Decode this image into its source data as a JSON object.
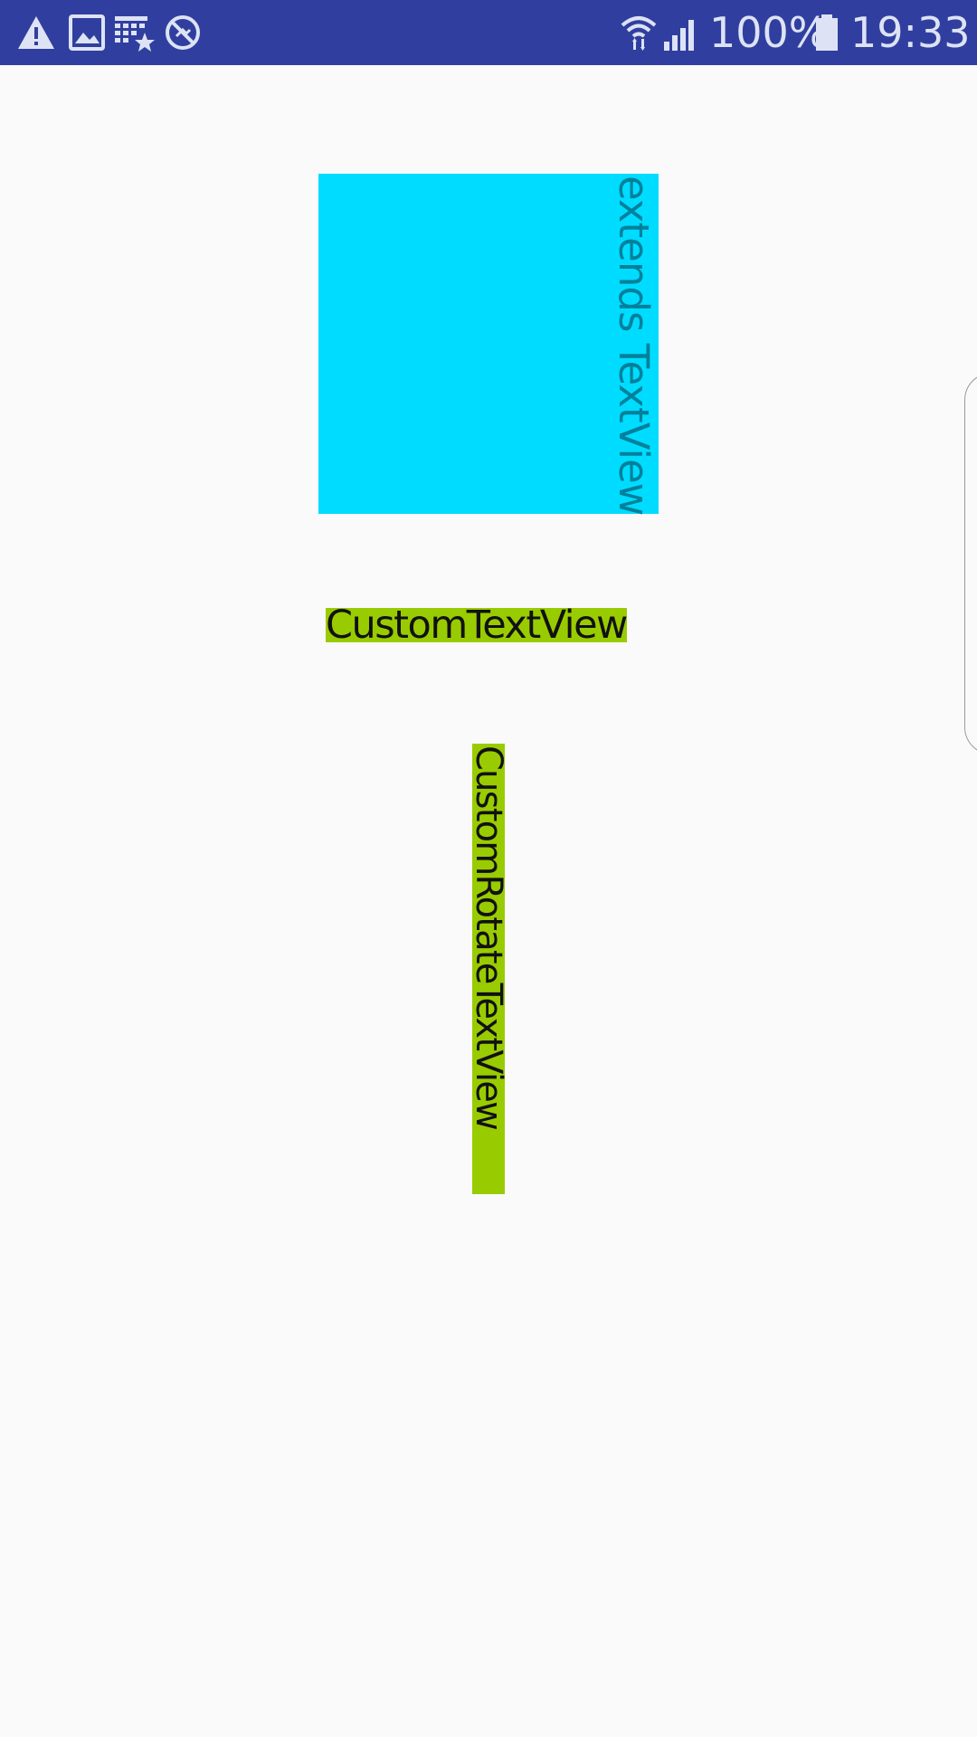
{
  "status_bar": {
    "battery_percent": "100%",
    "time": "19:33",
    "left_icons": [
      "warning-icon",
      "image-icon",
      "calendar-star-icon",
      "blocked-icon"
    ],
    "right_icons": [
      "wifi-icon",
      "signal-icon",
      "battery-icon"
    ],
    "background_color": "#303f9f"
  },
  "content": {
    "rotated_textview": {
      "text": "extends TextView",
      "background_color": "#00dcff",
      "text_color": "#00809b"
    },
    "custom_textview": {
      "text": "CustomTextView",
      "background_color": "#99cc00"
    },
    "custom_rotate_textview": {
      "text": "CustomRotateTextView",
      "background_color": "#99cc00"
    },
    "edge_panel_handle": "edge-panel-handle"
  }
}
